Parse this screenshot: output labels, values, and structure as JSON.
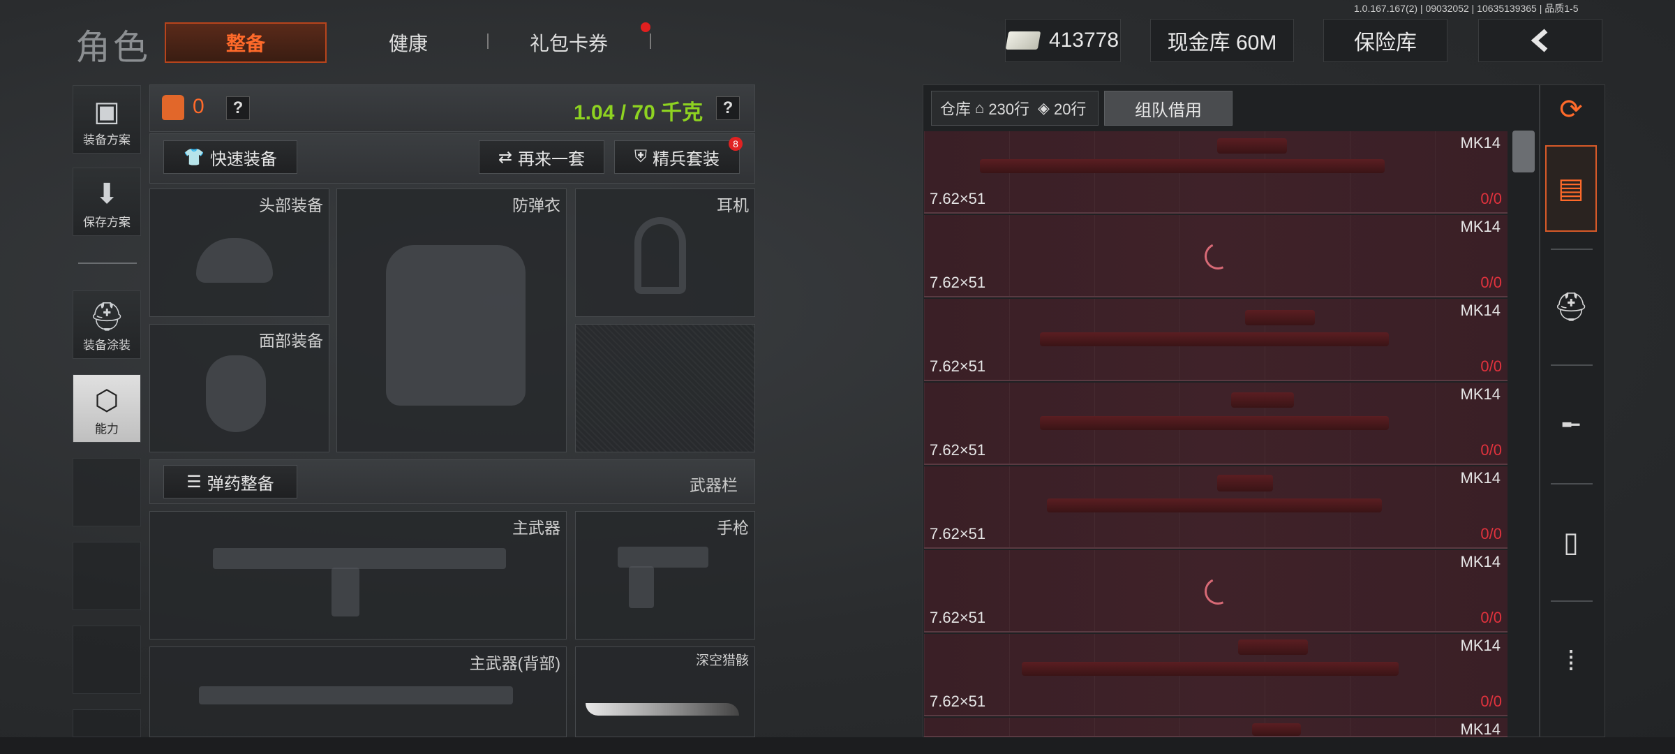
{
  "version": "1.0.167.167(2) | 09032052 | 10635139365 | 品质1-5",
  "header": {
    "title": "角色",
    "tabs": [
      {
        "label": "整备",
        "active": true
      },
      {
        "label": "健康",
        "active": false
      },
      {
        "label": "礼包卡券",
        "active": false,
        "notification": true
      }
    ],
    "currency": "413778",
    "cash_vault": "现金库 60M",
    "insurance": "保险库",
    "back_icon": "chevron-left-icon"
  },
  "sidebar": {
    "items": [
      {
        "label": "装备方案",
        "icon": "vest-icon"
      },
      {
        "label": "保存方案",
        "icon": "download-icon"
      },
      {
        "label": "装备涂装",
        "icon": "helmet-paint-icon"
      },
      {
        "label": "能力",
        "icon": "lightning-hex-icon",
        "active": true
      }
    ]
  },
  "loadout": {
    "armor_value": "0",
    "weight": "1.04 / 70 千克",
    "buttons": {
      "quick_equip": "快速装备",
      "again": "再来一套",
      "elite_kit": "精兵套装",
      "elite_badge": "8",
      "ammo": "弹药整备"
    },
    "slots": {
      "head": "头部装备",
      "vest": "防弹衣",
      "headset": "耳机",
      "face": "面部装备",
      "weapon_bar": "武器栏",
      "primary": "主武器",
      "pistol": "手枪",
      "primary_back": "主武器(背部)",
      "melee": "深空猎骸"
    }
  },
  "storage": {
    "warehouse_label": "仓库",
    "rows_main": "230行",
    "rows_ticket": "20行",
    "team_borrow": "组队借用",
    "items": [
      {
        "name": "MK14",
        "caliber": "7.62×51",
        "count_a": "0",
        "count_b": "0",
        "loaded": true
      },
      {
        "name": "MK14",
        "caliber": "7.62×51",
        "count_a": "0",
        "count_b": "0",
        "loaded": false
      },
      {
        "name": "MK14",
        "caliber": "7.62×51",
        "count_a": "0",
        "count_b": "0",
        "loaded": true
      },
      {
        "name": "MK14",
        "caliber": "7.62×51",
        "count_a": "0",
        "count_b": "0",
        "loaded": true
      },
      {
        "name": "MK14",
        "caliber": "7.62×51",
        "count_a": "0",
        "count_b": "0",
        "loaded": true
      },
      {
        "name": "MK14",
        "caliber": "7.62×51",
        "count_a": "0",
        "count_b": "0",
        "loaded": false
      },
      {
        "name": "MK14",
        "caliber": "7.62×51",
        "count_a": "0",
        "count_b": "0",
        "loaded": true
      },
      {
        "name": "MK14",
        "caliber": "",
        "count_a": "",
        "count_b": "",
        "loaded": true
      }
    ]
  },
  "filters": [
    "stack-refresh-icon",
    "box-layers-icon",
    "helmet-icon",
    "rifle-icon",
    "magazine-icon",
    "bullet-icon"
  ],
  "colors": {
    "accent": "#ff6a2a",
    "weight_green": "#8ed321",
    "alert_red": "#e0323d"
  }
}
